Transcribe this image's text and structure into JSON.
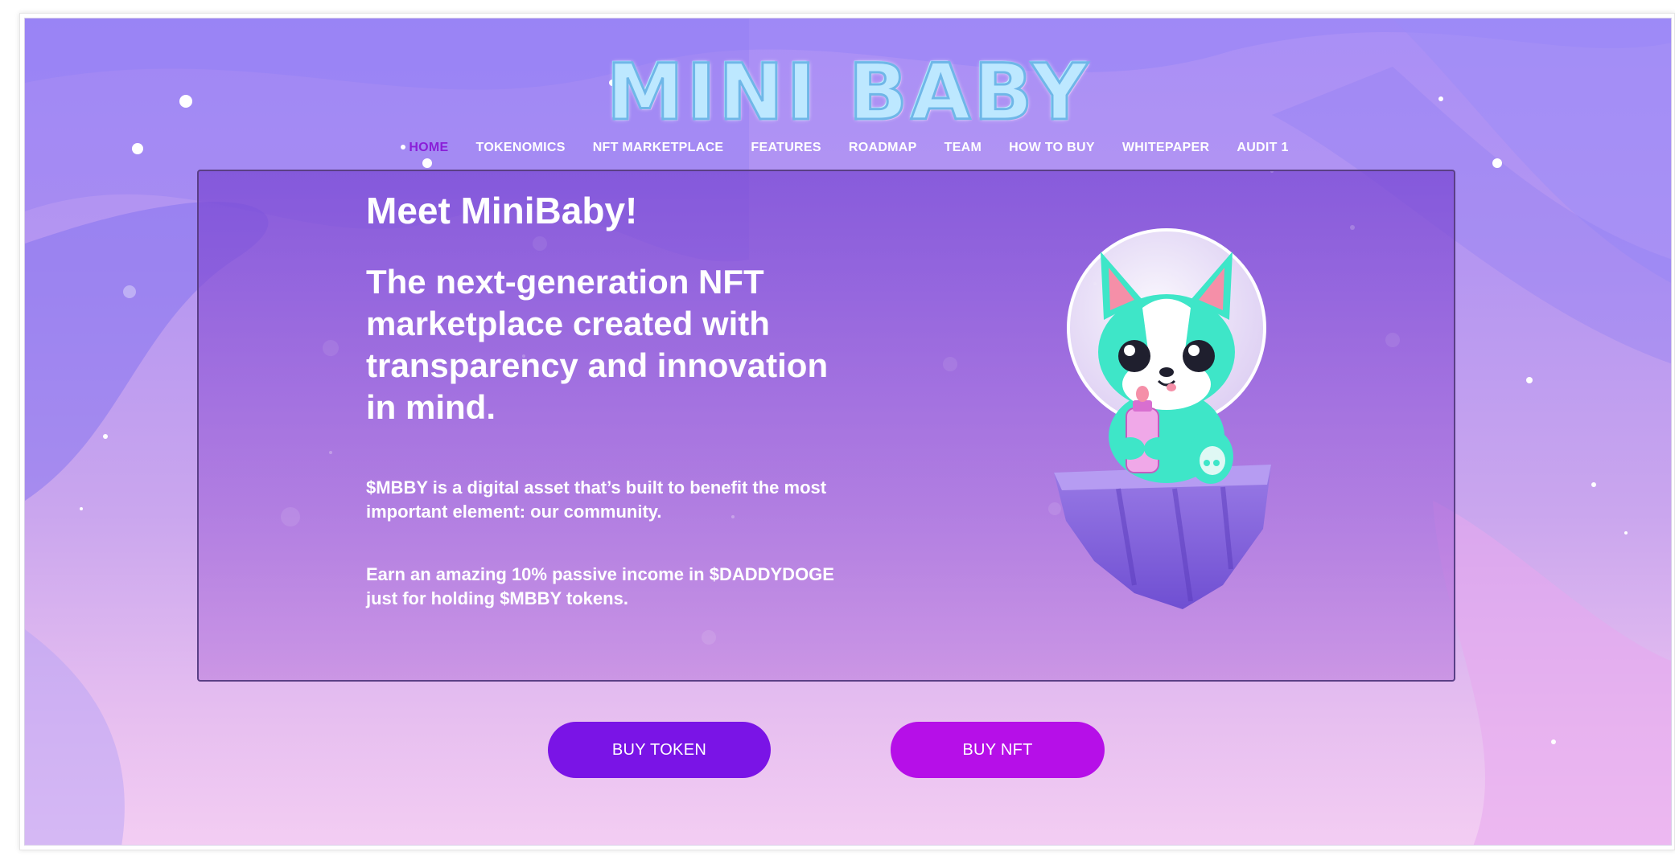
{
  "logo": {
    "text": "MINI BABY"
  },
  "nav": {
    "items": [
      {
        "label": "HOME",
        "active": true
      },
      {
        "label": "TOKENOMICS",
        "active": false
      },
      {
        "label": "NFT MARKETPLACE",
        "active": false
      },
      {
        "label": "FEATURES",
        "active": false
      },
      {
        "label": "ROADMAP",
        "active": false
      },
      {
        "label": "TEAM",
        "active": false
      },
      {
        "label": "HOW TO BUY",
        "active": false
      },
      {
        "label": "WHITEPAPER",
        "active": false
      },
      {
        "label": "AUDIT 1",
        "active": false
      }
    ]
  },
  "hero": {
    "heading": "Meet MiniBaby!",
    "subheading": "The next-generation NFT marketplace created with transparency and innovation in mind.",
    "paragraph1": "$MBBY is a digital asset that’s built to benefit the most important element: our community.",
    "paragraph2": "Earn an amazing 10% passive income in $DADDYDOGE just for holding $MBBY tokens."
  },
  "buttons": {
    "buy_token": "BUY TOKEN",
    "buy_nft": "BUY NFT"
  },
  "colors": {
    "active_nav": "#8a1fd8",
    "buy_token_bg": "#7a14e6",
    "buy_nft_bg": "#b60fe8",
    "mascot_body": "#3ee6c8"
  }
}
